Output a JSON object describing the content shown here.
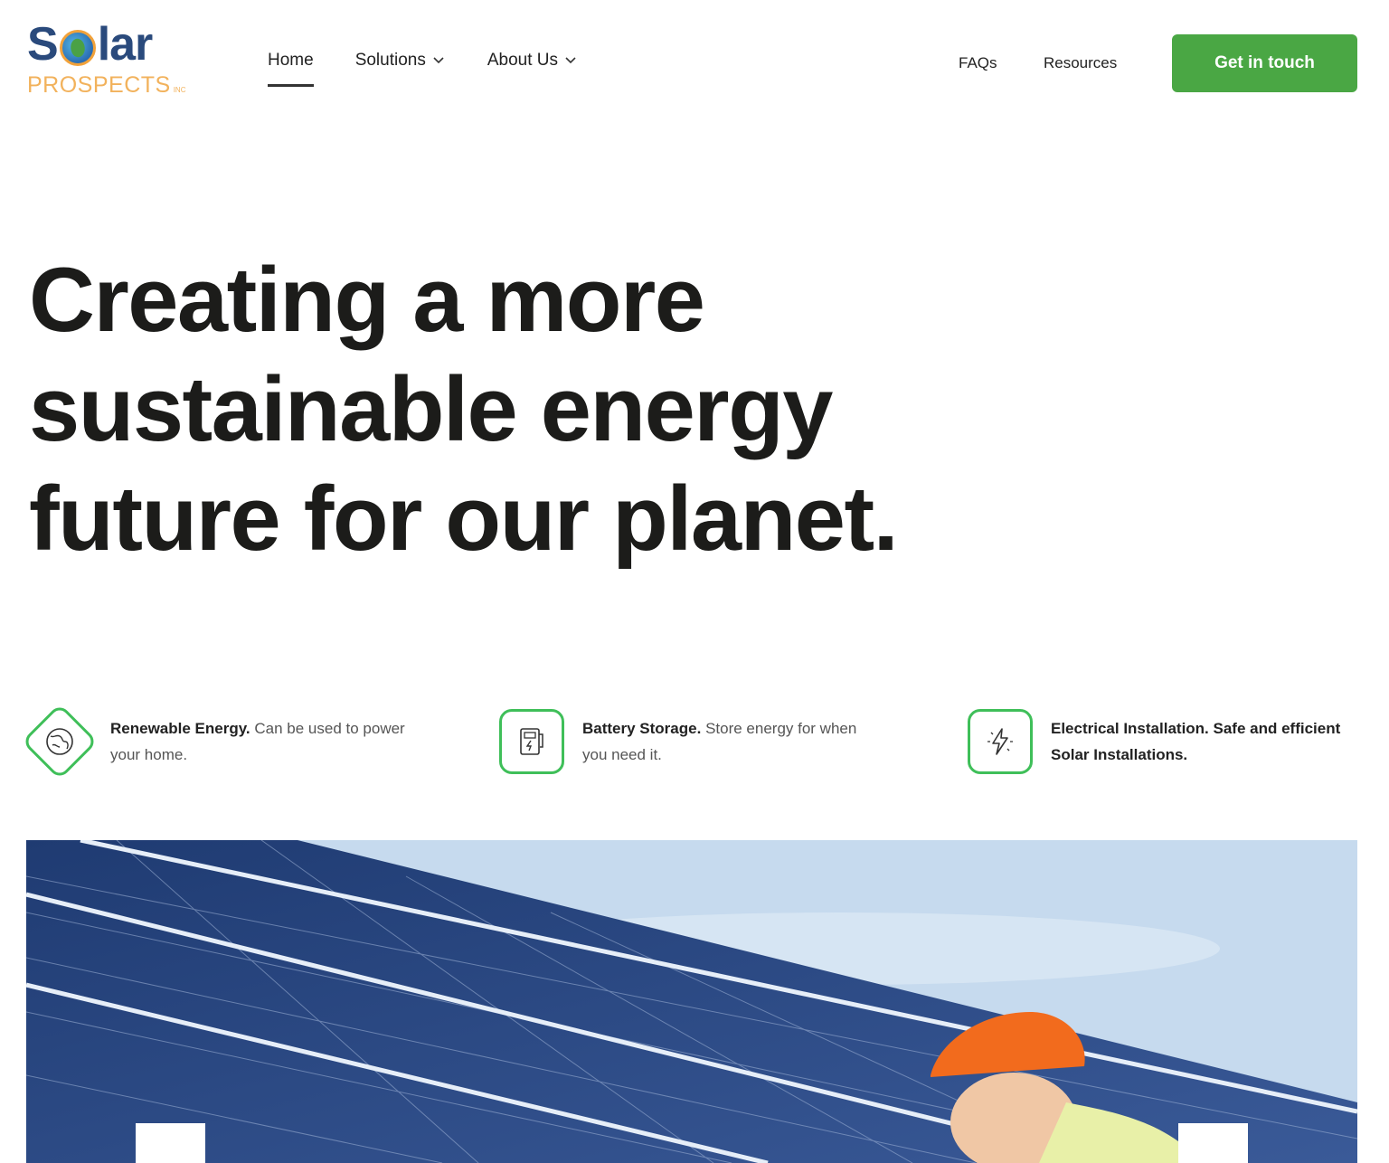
{
  "brand": {
    "logo_word_left": "S",
    "logo_word_right": "lar",
    "logo_sub": "PROSPECTS",
    "logo_inc": "INC",
    "colors": {
      "blue": "#2a4a7c",
      "orange": "#f2b25c",
      "green": "#4aa744"
    }
  },
  "nav": {
    "items": [
      {
        "label": "Home",
        "active": true,
        "dropdown": false
      },
      {
        "label": "Solutions",
        "active": false,
        "dropdown": true
      },
      {
        "label": "About Us",
        "active": false,
        "dropdown": true
      }
    ],
    "util_links": [
      {
        "label": "FAQs"
      },
      {
        "label": "Resources"
      }
    ],
    "cta_label": "Get in touch"
  },
  "hero": {
    "title": "Creating a more sustainable energy future for our planet."
  },
  "features": [
    {
      "icon": "globe-icon",
      "title": "Renewable Energy.",
      "text": "Can be used to power your home."
    },
    {
      "icon": "battery-icon",
      "title": "Battery Storage.",
      "text": "Store energy for when you need it."
    },
    {
      "icon": "lightning-icon",
      "title": "Electrical Installation.",
      "text": "Safe and efficient Solar Installations."
    }
  ],
  "hero_image": {
    "alt": "solar-panels-worker-photo",
    "accent": "#f26b1d"
  }
}
